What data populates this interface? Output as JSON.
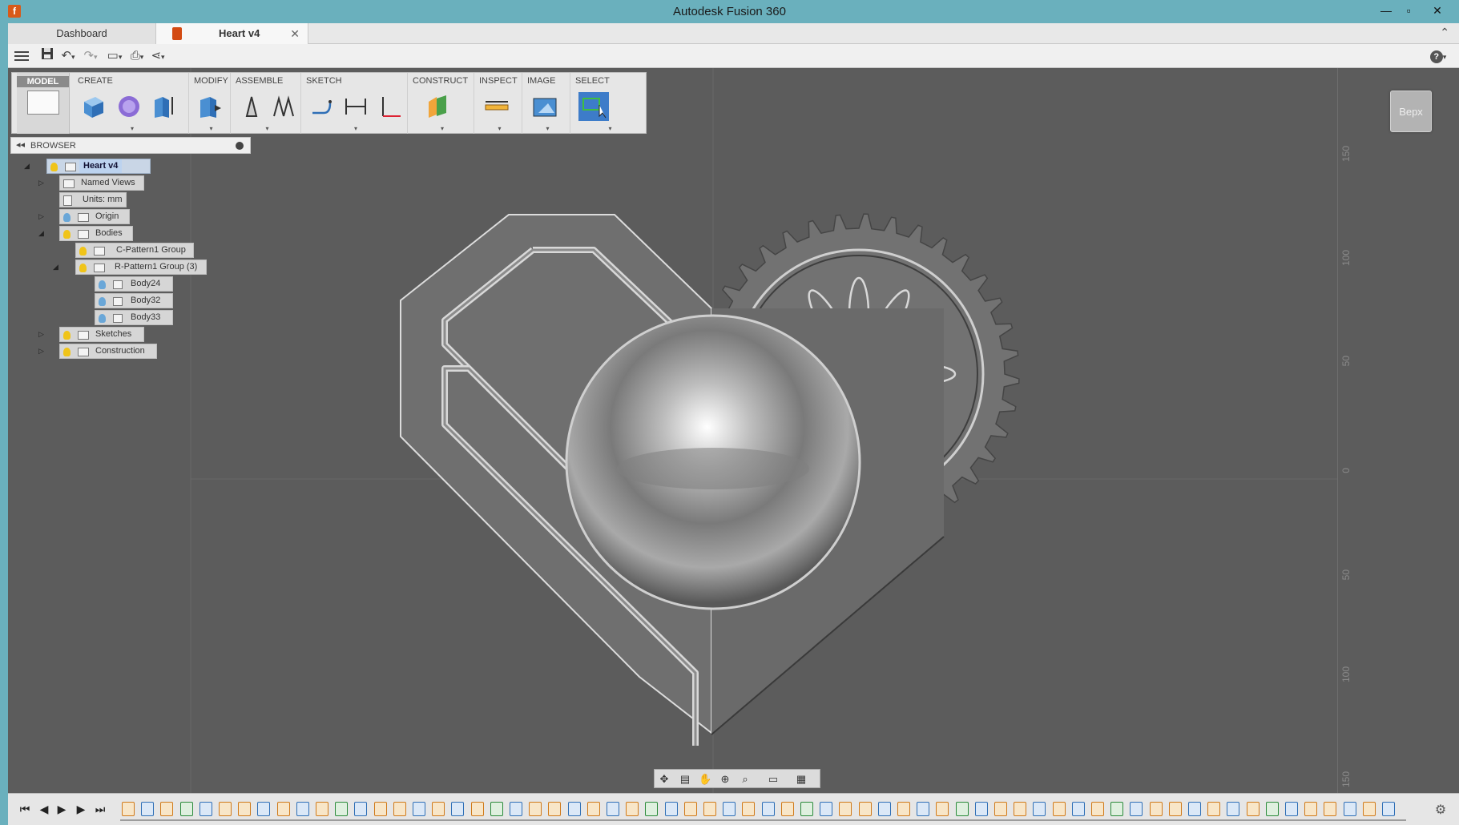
{
  "window": {
    "title": "Autodesk Fusion 360",
    "minimize": "—",
    "maximize": "▫",
    "close": "✕"
  },
  "tabs": {
    "dashboard": "Dashboard",
    "active": "Heart v4",
    "close": "✕"
  },
  "qat": {
    "help": "?"
  },
  "ribbon": {
    "workspace": "MODEL",
    "groups": [
      "CREATE",
      "MODIFY",
      "ASSEMBLE",
      "SKETCH",
      "CONSTRUCT",
      "INSPECT",
      "IMAGE",
      "SELECT"
    ]
  },
  "viewcube": {
    "label": "Верх"
  },
  "browser": {
    "title": "BROWSER",
    "collapse": "◂◂",
    "nodes": [
      {
        "label": "Heart v4"
      },
      {
        "label": "Named Views"
      },
      {
        "label": "Units: mm"
      },
      {
        "label": "Origin"
      },
      {
        "label": "Bodies"
      },
      {
        "label": "C-Pattern1 Group"
      },
      {
        "label": "R-Pattern1 Group (3)"
      },
      {
        "label": "Body24"
      },
      {
        "label": "Body32"
      },
      {
        "label": "Body33"
      },
      {
        "label": "Sketches"
      },
      {
        "label": "Construction"
      }
    ]
  },
  "ruler": {
    "ticks": [
      "150",
      "100",
      "50",
      "0",
      "50",
      "100",
      "150"
    ]
  },
  "timeline": {
    "controls": [
      "⏮",
      "◀",
      "▶",
      "▶",
      "⏭"
    ]
  }
}
